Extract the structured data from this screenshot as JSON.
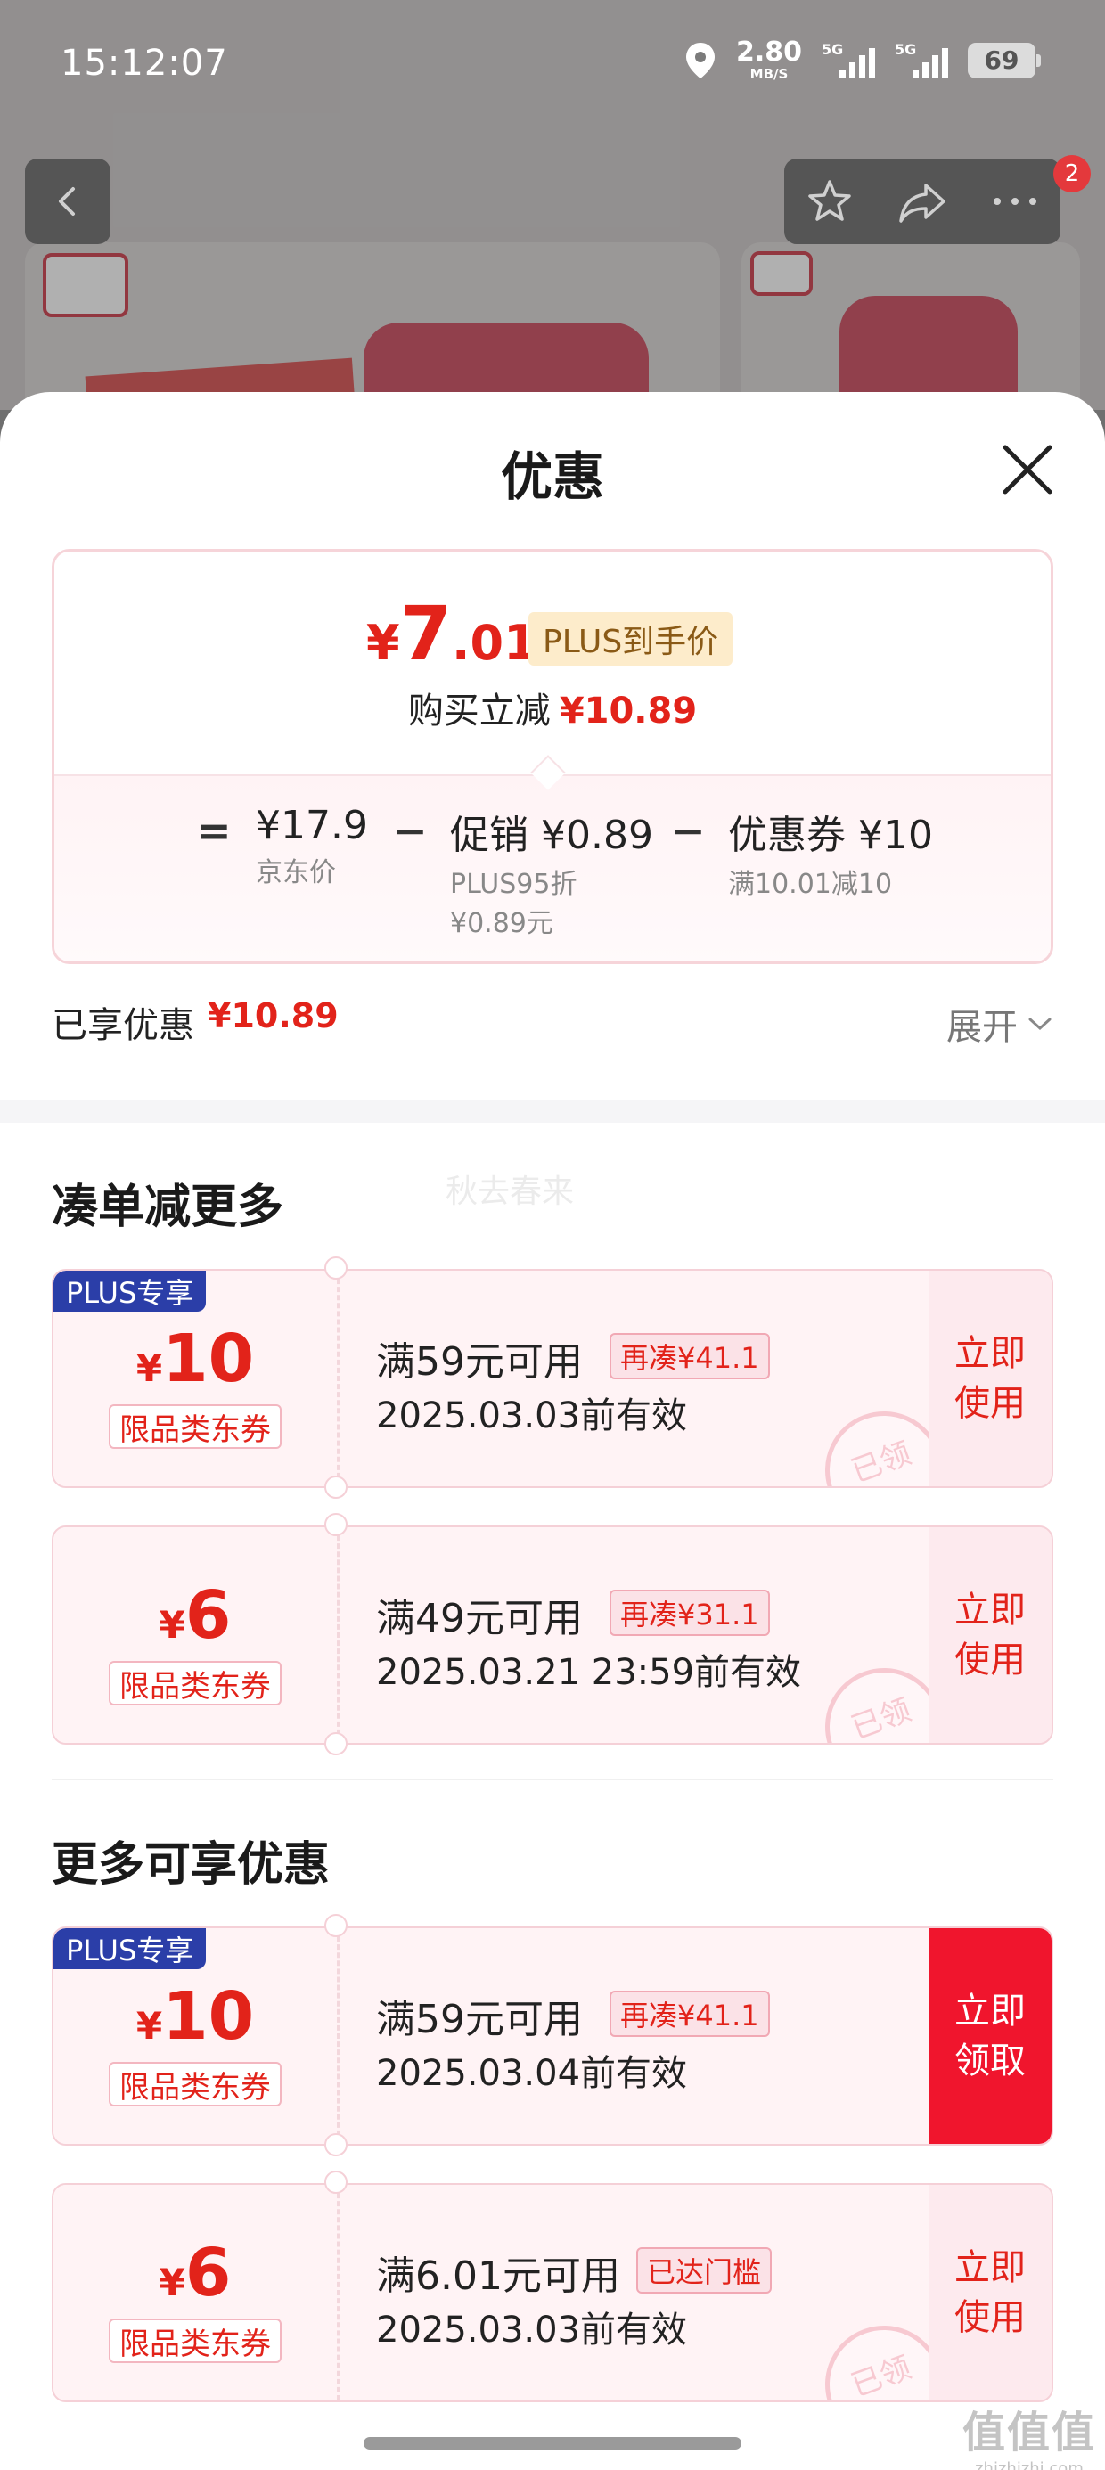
{
  "status_bar": {
    "time": "15:12:07",
    "net_speed": "2.80",
    "net_unit": "MB/S",
    "sim1": "5G",
    "sim2": "5G",
    "battery": "69"
  },
  "top_badge": "2",
  "sheet": {
    "title": "优惠"
  },
  "price_summary": {
    "currency": "¥",
    "price_int": "7",
    "price_dec": ".01",
    "plus_tag": "PLUS到手价",
    "reduce_label": "购买立减",
    "reduce_amount": "¥10.89",
    "equals": "=",
    "minus": "−",
    "jd_price": "¥17.9",
    "jd_price_label": "京东价",
    "promo_main": "促销 ¥0.89",
    "promo_sub1": "PLUS95折",
    "promo_sub2": "¥0.89元",
    "coupon_main": "优惠券 ¥10",
    "coupon_sub": "满10.01减10"
  },
  "enjoyed": {
    "label": "已享优惠",
    "amount": "¥10.89",
    "expand": "展开"
  },
  "watermark": "秋去春来",
  "section1": {
    "title": "凑单减更多",
    "coupons": [
      {
        "plus_tag": "PLUS专享",
        "currency": "¥",
        "amount": "10",
        "type": "限品类东券",
        "condition": "满59元可用",
        "need": "再凑¥41.1",
        "valid": "2025.03.03前有效",
        "action": "立即使用",
        "stamp": "已领"
      },
      {
        "currency": "¥",
        "amount": "6",
        "type": "限品类东券",
        "condition": "满49元可用",
        "need": "再凑¥31.1",
        "valid": "2025.03.21 23:59前有效",
        "action": "立即使用",
        "stamp": "已领"
      }
    ]
  },
  "section2": {
    "title": "更多可享优惠",
    "coupons": [
      {
        "plus_tag": "PLUS专享",
        "currency": "¥",
        "amount": "10",
        "type": "限品类东券",
        "condition": "满59元可用",
        "need": "再凑¥41.1",
        "valid": "2025.03.04前有效",
        "action": "立即领取"
      },
      {
        "currency": "¥",
        "amount": "6",
        "type": "限品类东券",
        "condition": "满6.01元可用",
        "need": "已达门槛",
        "valid": "2025.03.03前有效",
        "action": "立即使用",
        "stamp": "已领"
      }
    ]
  },
  "corner_mark": {
    "big": "值值值",
    "small": "zhizhizhi.com"
  },
  "colors": {
    "accent_red": "#e2231a",
    "plus_blue": "#2b3ea8",
    "claim_red": "#f0152d"
  }
}
